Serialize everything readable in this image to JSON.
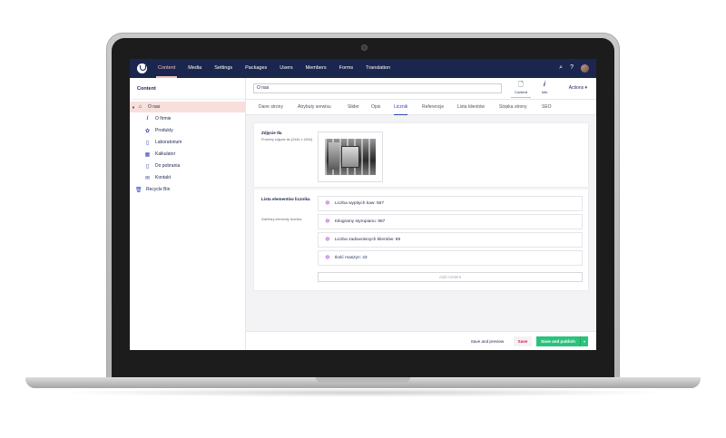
{
  "topbar": {
    "sections": [
      "Content",
      "Media",
      "Settings",
      "Packages",
      "Users",
      "Members",
      "Forms",
      "Translation"
    ],
    "active_section": "Content",
    "search_icon": "search-icon",
    "help_icon": "help-icon",
    "bg_color": "#1b264f",
    "accent_color": "#f5c1bc"
  },
  "sidebar": {
    "title": "Content",
    "items": [
      {
        "label": "O nas",
        "icon": "home-icon"
      },
      {
        "label": "O firmie",
        "icon": "info-icon"
      },
      {
        "label": "Produkty",
        "icon": "gear-icon"
      },
      {
        "label": "Laboratorium",
        "icon": "document-icon"
      },
      {
        "label": "Kalkulator",
        "icon": "calculator-icon"
      },
      {
        "label": "Do pobrania",
        "icon": "document-icon"
      },
      {
        "label": "Kontakt",
        "icon": "mail-icon"
      },
      {
        "label": "Recycle Bin",
        "icon": "trash-icon"
      }
    ]
  },
  "editor": {
    "name_value": "O nas",
    "apps": [
      {
        "label": "Content",
        "glyph": "🗋"
      },
      {
        "label": "Info",
        "glyph": "i"
      }
    ],
    "actions_label": "Actions ▾"
  },
  "tabs": [
    "Dane strony",
    "Atrybuty serwisu",
    "Slider",
    "Opis",
    "Licznik",
    "Referencje",
    "Lista klientów",
    "Stopka strony",
    "SEO"
  ],
  "active_tab": "Licznik",
  "fields": {
    "image": {
      "label": "Zdjęcie tła",
      "description": "Prosimy zdjęcie tła (2440 x 1600)"
    },
    "counter": {
      "label": "Lista elementów licznika",
      "description": "Zdefiniuj elementy licznika",
      "items": [
        "Liczba wypitych kaw: 567",
        "Kilogramy styropianu: 987",
        "Liczba zadowolonych klientów: 89",
        "Ilość maszyn: 43"
      ],
      "add_label": "Add content"
    }
  },
  "footer": {
    "preview_label": "Save and preview",
    "save_label": "Save",
    "publish_label": "Save and publish",
    "caret": "▾"
  }
}
